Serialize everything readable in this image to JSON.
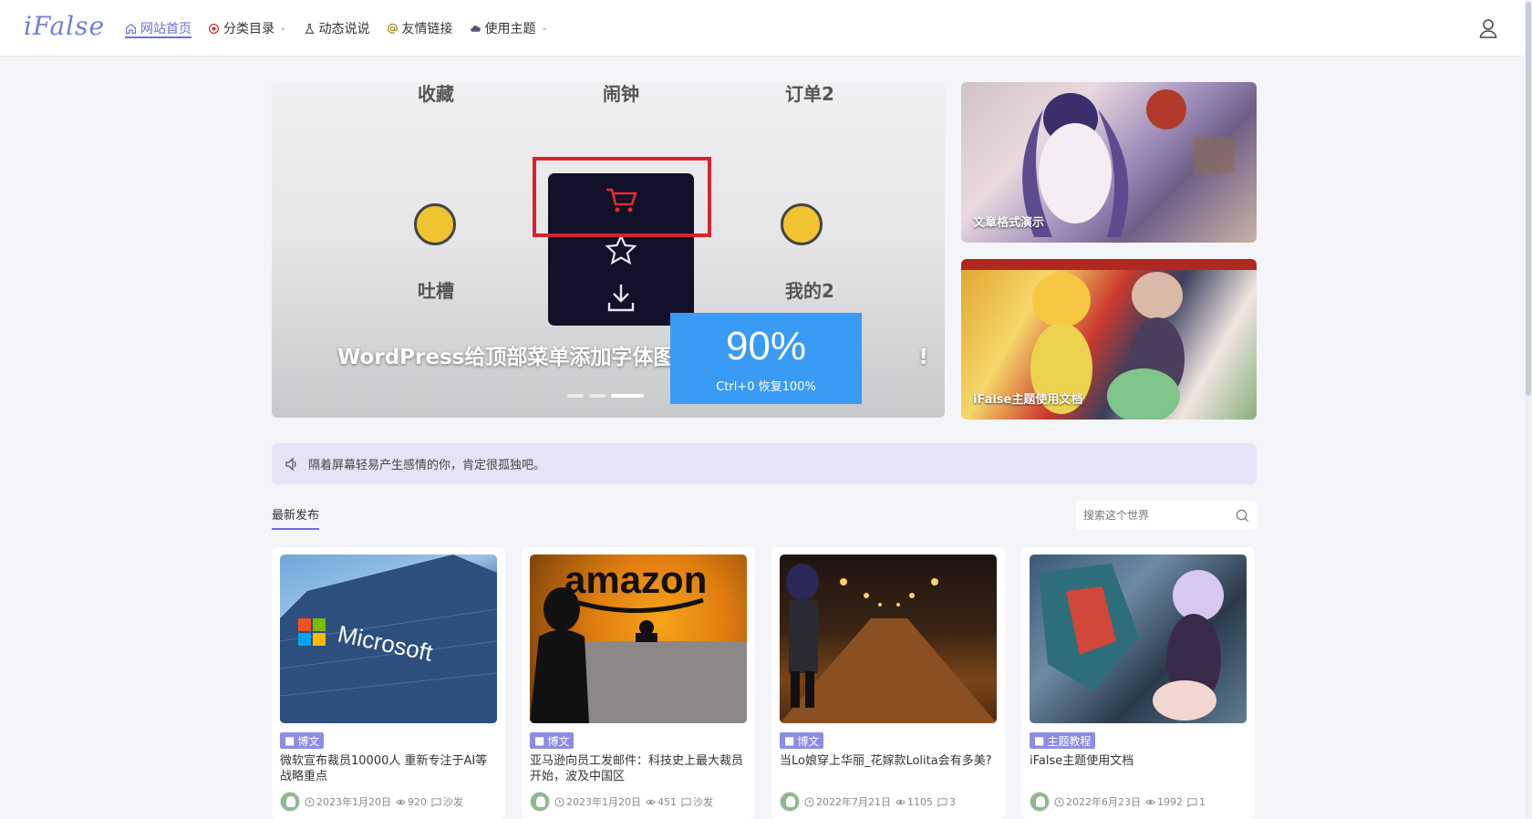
{
  "header": {
    "logo": "iFalse",
    "nav": [
      {
        "label": "网站首页",
        "icon": "home-icon",
        "active": true
      },
      {
        "label": "分类目录",
        "icon": "category-icon",
        "dropdown": true
      },
      {
        "label": "动态说说",
        "icon": "flask-icon"
      },
      {
        "label": "友情链接",
        "icon": "at-icon"
      },
      {
        "label": "使用主题",
        "icon": "cloud-icon",
        "dropdown": true
      }
    ],
    "user_icon": "user-icon"
  },
  "slider": {
    "app_labels": [
      "收藏",
      "闹钟",
      "订单2",
      "吐槽",
      "我的2"
    ],
    "title": "WordPress给顶部菜单添加字体图标，",
    "title_tail": "!",
    "active_dot": 2
  },
  "zoom": {
    "value": "90%",
    "hint": "Ctrl+0 恢复100%"
  },
  "side_cards": [
    {
      "label": "文章格式演示"
    },
    {
      "label": "iFalse主题使用文档"
    }
  ],
  "notice": {
    "text": "隔着屏幕轻易产生感情的你，肯定很孤独吧。",
    "icon": "speaker-icon"
  },
  "section": {
    "title": "最新发布"
  },
  "search": {
    "placeholder": "搜索这个世界"
  },
  "posts": [
    {
      "category": "博文",
      "title": "微软宣布裁员10000人 重新专注于AI等战略重点",
      "date": "2023年1月20日",
      "views": "920",
      "comments": "沙发"
    },
    {
      "category": "博文",
      "title": "亚马逊向员工发邮件：科技史上最大裁员开始，波及中国区",
      "date": "2023年1月20日",
      "views": "451",
      "comments": "沙发"
    },
    {
      "category": "博文",
      "title": "当Lo娘穿上华丽_花嫁款Lolita会有多美?",
      "date": "2022年7月21日",
      "views": "1105",
      "comments": "3"
    },
    {
      "category": "主题教程",
      "title": "iFalse主题使用文档",
      "date": "2022年6月23日",
      "views": "1992",
      "comments": "1"
    }
  ],
  "colors": {
    "accent": "#6b6fd9",
    "zoom_badge": "#3a9bf4",
    "notice_bg": "#e5e4f6",
    "category_tag": "#8b8ee4"
  }
}
